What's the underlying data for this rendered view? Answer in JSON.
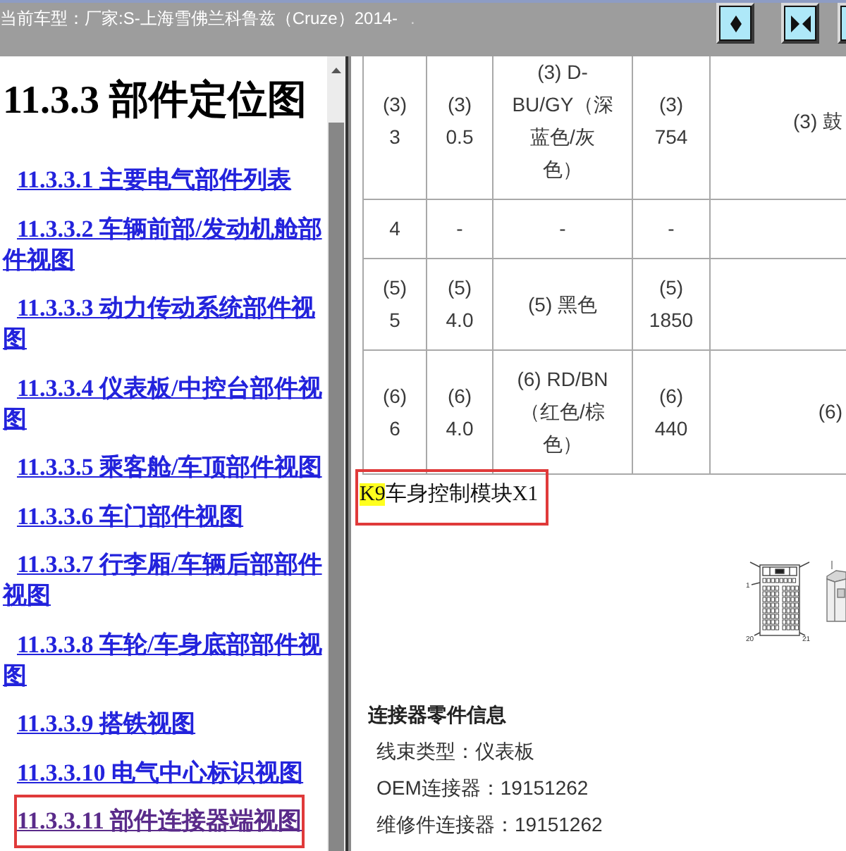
{
  "header": {
    "title": "当前车型：厂家:S-上海雪佛兰科鲁兹（Cruze）2014-",
    "mark": ".",
    "buttons": [
      {
        "kind": "single"
      },
      {
        "kind": "double"
      },
      {
        "kind": "partial"
      }
    ]
  },
  "sidebar": {
    "title": "11.3.3 部件定位图",
    "items": [
      {
        "label": "11.3.3.1 主要电气部件列表",
        "selected": false
      },
      {
        "label": "11.3.3.2 车辆前部/发动机舱部件视图",
        "selected": false
      },
      {
        "label": "11.3.3.3 动力传动系统部件视图",
        "selected": false
      },
      {
        "label": "11.3.3.4 仪表板/中控台部件视图",
        "selected": false
      },
      {
        "label": "11.3.3.5 乘客舱/车顶部件视图",
        "selected": false
      },
      {
        "label": "11.3.3.6 车门部件视图",
        "selected": false
      },
      {
        "label": "11.3.3.7 行李厢/车辆后部部件视图",
        "selected": false
      },
      {
        "label": "11.3.3.8 车轮/车身底部部件视图",
        "selected": false
      },
      {
        "label": "11.3.3.9 搭铁视图",
        "selected": false
      },
      {
        "label": "11.3.3.10 电气中心标识视图",
        "selected": false
      },
      {
        "label": "11.3.3.11 部件连接器端视图",
        "selected": true
      }
    ]
  },
  "table": {
    "rows": [
      {
        "column_1": "(3) 3",
        "column_2": "(3) 0.5",
        "column_3": "(3) D-BU/GY（深蓝色/灰色）",
        "column_4": "(3) 754",
        "column_5": "(3) 鼓"
      },
      {
        "column_1": "4",
        "column_2": "-",
        "column_3": "-",
        "column_4": "-"
      },
      {
        "column_1": "(5) 5",
        "column_2": "(5) 4.0",
        "column_3": "(5) 黑色",
        "column_4": "(5) 1850"
      },
      {
        "column_1": "(6) 6",
        "column_2": "(6) 4.0",
        "column_3": "(6) RD/BN（红色/棕色）",
        "column_4": "(6) 440",
        "column_5": "(6)"
      }
    ]
  },
  "caption": {
    "code": "K9",
    "name": "车身控制模块X1",
    "outlined": true
  },
  "connector_diagram": {
    "pin_labels": [
      "1",
      "20",
      "21"
    ]
  },
  "part_info": {
    "heading": "连接器零件信息",
    "lines": [
      "线束类型：仪表板",
      "OEM连接器：19151262",
      "维修件连接器：19151262"
    ]
  }
}
